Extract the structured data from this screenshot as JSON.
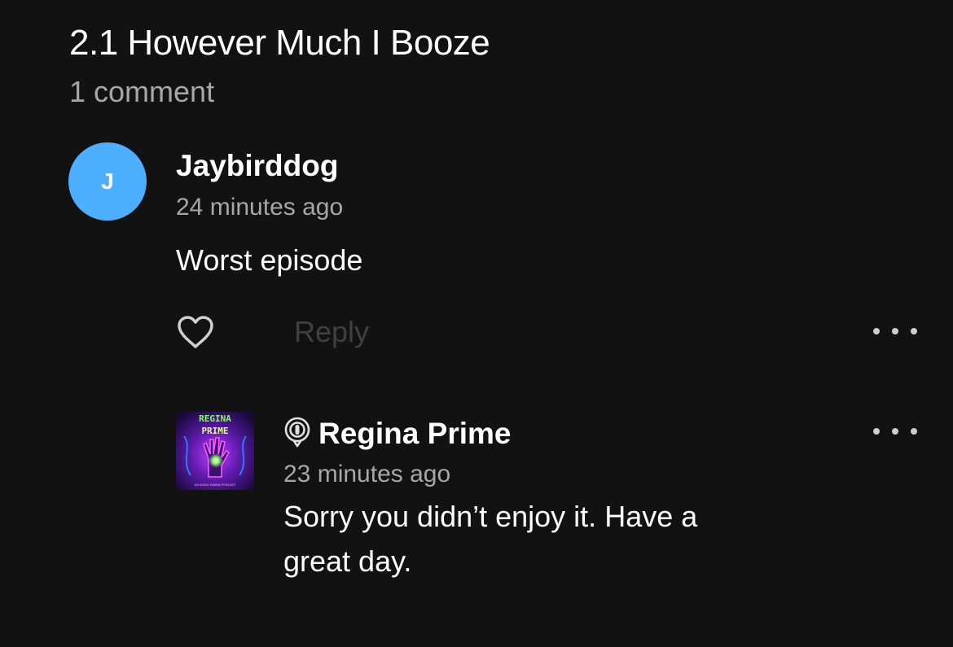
{
  "episode": {
    "title": "2.1 However Much I Booze",
    "comment_count": "1 comment"
  },
  "comments": [
    {
      "avatar_letter": "J",
      "author": "Jaybirddog",
      "time": "24 minutes ago",
      "text": "Worst episode",
      "reply_label": "Reply",
      "avatar_color": "#4dafff"
    }
  ],
  "replies": [
    {
      "author": "Regina Prime",
      "time": "23 minutes ago",
      "text": "Sorry you didn’t enjoy it. Have a great day.",
      "cover_art_text": {
        "line1": "REGINA",
        "line2": "PRIME",
        "tagline": "AN AUDIO DRAMA PODCAST"
      }
    }
  ],
  "icons": {
    "like": "heart-outline-icon",
    "more": "more-horizontal-icon",
    "creator_badge": "podcast-creator-icon"
  },
  "colors": {
    "background": "#121212",
    "text_primary": "#ffffff",
    "text_secondary": "#a7a7a7",
    "reply_disabled": "#404040",
    "avatar_blue": "#4dafff"
  }
}
